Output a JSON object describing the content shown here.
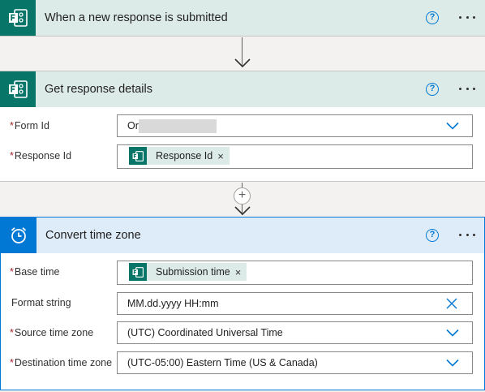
{
  "trigger": {
    "title": "When a new response is submitted",
    "icon": "microsoft-forms-icon",
    "help_glyph": "?"
  },
  "get_response": {
    "title": "Get response details",
    "icon": "microsoft-forms-icon",
    "help_glyph": "?",
    "fields": {
      "form_id": {
        "required_mark": "*",
        "label": "Form Id",
        "value": "Or"
      },
      "response_id": {
        "required_mark": "*",
        "label": "Response Id",
        "token": "Response Id",
        "token_remove": "×"
      }
    }
  },
  "add_step": {
    "glyph": "+"
  },
  "convert": {
    "title": "Convert time zone",
    "icon": "alarm-clock-icon",
    "help_glyph": "?",
    "fields": {
      "base_time": {
        "required_mark": "*",
        "label": "Base time",
        "token": "Submission time",
        "token_remove": "×"
      },
      "format_string": {
        "label": "Format string",
        "value": "MM.dd.yyyy HH:mm"
      },
      "source_tz": {
        "required_mark": "*",
        "label": "Source time zone",
        "value": "(UTC) Coordinated Universal Time"
      },
      "dest_tz": {
        "required_mark": "*",
        "label": "Destination time zone",
        "value": "(UTC-05:00) Eastern Time (US & Canada)"
      }
    }
  },
  "colors": {
    "forms_green": "#077568",
    "forms_header_bg": "#dcebe8",
    "convert_header_bg": "#deecf9",
    "accent_blue": "#0078d4",
    "required_red": "#a4262c"
  }
}
